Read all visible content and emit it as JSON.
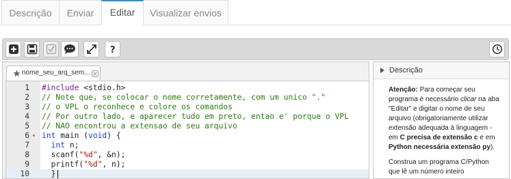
{
  "tabs": [
    {
      "label": "Descrição"
    },
    {
      "label": "Enviar"
    },
    {
      "label": "Editar"
    },
    {
      "label": "Visualizar envios"
    }
  ],
  "toolbar": {
    "buttons": [
      "plus-icon",
      "save-icon",
      "check-icon",
      "comment-icon",
      "fullscreen-icon",
      "help-icon",
      "clock-icon"
    ]
  },
  "file_tab": {
    "label": "nome_seu_arq_sem..."
  },
  "code_lines": [
    {
      "n": "1",
      "text": "#include <stdio.h>"
    },
    {
      "n": "2",
      "text": "// Note que, se colocar o nome corretamente, com um unico \".\""
    },
    {
      "n": "3",
      "text": "// o VPL o reconhece e colore os comandos"
    },
    {
      "n": "4",
      "text": "// Por outro lado, e aparecer tudo em preto, entao e' porque o VPL"
    },
    {
      "n": "5",
      "text": "// NAO encontrou a extensao de seu arquivo"
    },
    {
      "n": "6",
      "text": "int main (void) {"
    },
    {
      "n": "7",
      "text": "  int n;"
    },
    {
      "n": "8",
      "text": "  scanf(\"%d\", &n);"
    },
    {
      "n": "9",
      "text": "  printf(\"%d\", n);"
    },
    {
      "n": "10",
      "text": "  }"
    }
  ],
  "panel": {
    "title": "Descrição",
    "p1": {
      "bold1": "Atenção:",
      "t1": " Para começar seu programa é necessário ",
      "ital": "clicar",
      "t2": " na aba \"Editar\" e digitar o nome de seu arquivo (obrigatoriamente utilizar extensão adequada à linguagem - em ",
      "bold2": "C precisa de extensão c",
      "t3": " e em ",
      "bold3": "Python necessária extensão py",
      "t4": ")."
    },
    "p2": "Construa um programa C/Python que lê um número inteiro"
  }
}
